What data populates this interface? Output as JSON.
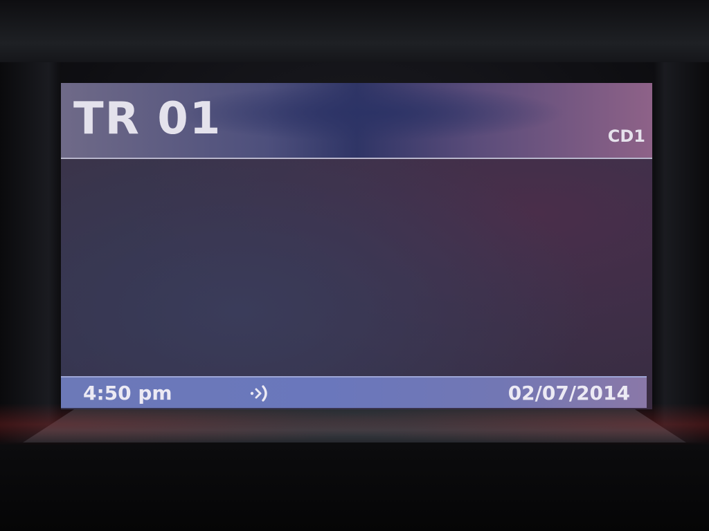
{
  "header": {
    "track": "TR 01",
    "source": "CD1"
  },
  "status_bar": {
    "time": "4:50 pm",
    "signal_icon": "broadcast-icon",
    "date": "02/07/2014"
  },
  "colors": {
    "header_bar": "#4d4f7c",
    "status_bar": "#6c79b8",
    "text": "#e8e4ee"
  }
}
